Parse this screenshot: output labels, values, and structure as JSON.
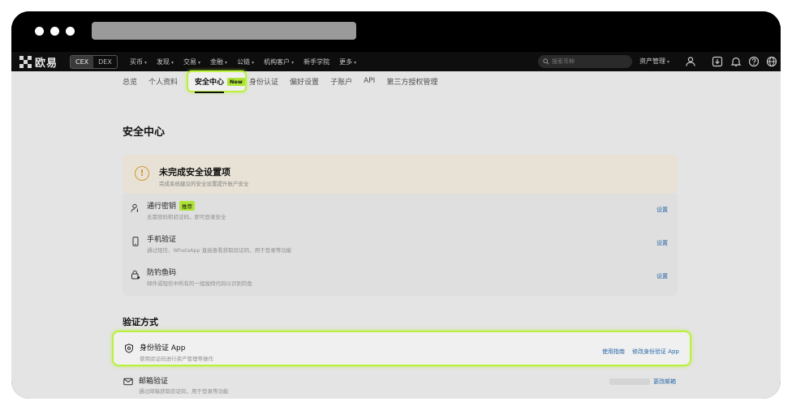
{
  "nav": {
    "logo_text": "欧易",
    "cex": "CEX",
    "dex": "DEX",
    "menu": [
      "买币",
      "发现",
      "交易",
      "金融",
      "公链",
      "机构客户",
      "新手学院",
      "更多"
    ],
    "menu_has_chevron": [
      true,
      true,
      true,
      true,
      true,
      true,
      false,
      true
    ],
    "search_placeholder": "搜索币种",
    "asset_label": "资产管理"
  },
  "tabs": {
    "items": [
      "总览",
      "个人资料"
    ],
    "active": "安全中心",
    "active_badge": "New",
    "rest": [
      "身份认证",
      "偏好设置",
      "子账户",
      "API",
      "第三方授权管理"
    ]
  },
  "page": {
    "title": "安全中心",
    "warning": {
      "title": "未完成安全设置项",
      "subtitle": "完成系统建议的安全设置提升账户安全"
    },
    "security_items": [
      {
        "title": "通行密钥",
        "badge": "推荐",
        "desc": "无需密码和验证码，即可登录安全",
        "action": "设置",
        "icon": "user-key-icon"
      },
      {
        "title": "手机验证",
        "badge": "",
        "desc": "通过短信、WhatsApp 直接查看获取验证码，用于登录等功能",
        "action": "设置",
        "icon": "phone-icon"
      },
      {
        "title": "防钓鱼码",
        "badge": "",
        "desc": "邮件或短信中所有的一组独特代码以识别钓鱼",
        "action": "设置",
        "icon": "lock-icon"
      }
    ],
    "verify_section_title": "验证方式",
    "auth_app": {
      "title": "身份验证 App",
      "desc": "使用验证码进行资产管理等操作",
      "guide": "使用指南",
      "modify": "修改身份验证 App",
      "icon": "shield-icon"
    },
    "email": {
      "title": "邮箱验证",
      "desc": "通过邮箱获取验证码，用于登录等功能",
      "action": "更改邮箱",
      "icon": "mail-icon"
    }
  },
  "colors": {
    "highlight": "#c6ff40",
    "link": "#2a6fb0",
    "warning": "#e0a030"
  }
}
